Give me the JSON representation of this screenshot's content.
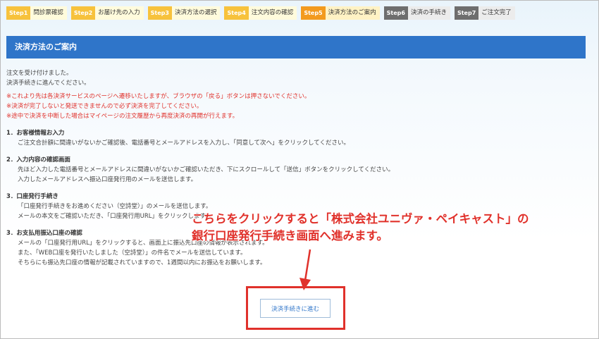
{
  "steps": [
    {
      "badge": "Step1",
      "label": "問診票確認",
      "state": "done"
    },
    {
      "badge": "Step2",
      "label": "お届け先の入力",
      "state": "done"
    },
    {
      "badge": "Step3",
      "label": "決済方法の選択",
      "state": "done"
    },
    {
      "badge": "Step4",
      "label": "注文内容の確認",
      "state": "done"
    },
    {
      "badge": "Step5",
      "label": "決済方法のご案内",
      "state": "current"
    },
    {
      "badge": "Step6",
      "label": "決済の手続き",
      "state": "todo"
    },
    {
      "badge": "Step7",
      "label": "ご注文完了",
      "state": "todo"
    }
  ],
  "section_title": "決済方法のご案内",
  "intro": [
    "注文を受け付けました。",
    "決済手続きに進んでください。"
  ],
  "warnings": [
    "※これより先は各決済サービスのページへ遷移いたしますが、ブラウザの「戻る」ボタンは押さないでください。",
    "※決済が完了しないと発送できませんので必ず決済を完了してください。",
    "※途中で決済を中断した場合はマイページの注文履歴から再度決済の再開が行えます。"
  ],
  "items": [
    {
      "title": "1．お客様情報お入力",
      "lines": [
        "ご注文合計額に間違いがないかご確認後、電話番号とメールアドレスを入力し、「同意して次へ」をクリックしてください。"
      ]
    },
    {
      "title": "2．入力内容の確認画面",
      "lines": [
        "先ほど入力した電話番号とメールアドレスに間違いがないかご確認いただき、下にスクロールして「送信」ボタンをクリックしてください。",
        "入力したメールアドレスへ振込口座発行用のメールを送信します。"
      ]
    },
    {
      "title": "3．口座発行手続き",
      "lines": [
        "「口座発行手続きをお進めください（空詩堂）」のメールを送信します。",
        "メールの本文をご確認いただき、「口座発行用URL」をクリックします。"
      ]
    },
    {
      "title": "3．お支払用振込口座の確認",
      "lines": [
        "メールの「口座発行用URL」をクリックすると、画面上に振込先口座の情報が表示されます。",
        "また、「WEB口座を発行いたしました（空詩堂）」の件名でメールを送信しています。",
        "そちらにも振込先口座の情報が記載されていますので、1週間以内にお振込をお願いします。"
      ]
    }
  ],
  "callout": [
    "こちらをクリックすると「株式会社ユニヴァ・ペイキャスト」の",
    "銀行口座発行手続き画面へ進みます。"
  ],
  "pay_button": "決済手続きに進む",
  "colors": {
    "accent": "#2f75c9",
    "warning": "#e0312b",
    "step_done": "#f7c23c",
    "step_current": "#f39a1e",
    "step_todo": "#6e6e6e"
  }
}
